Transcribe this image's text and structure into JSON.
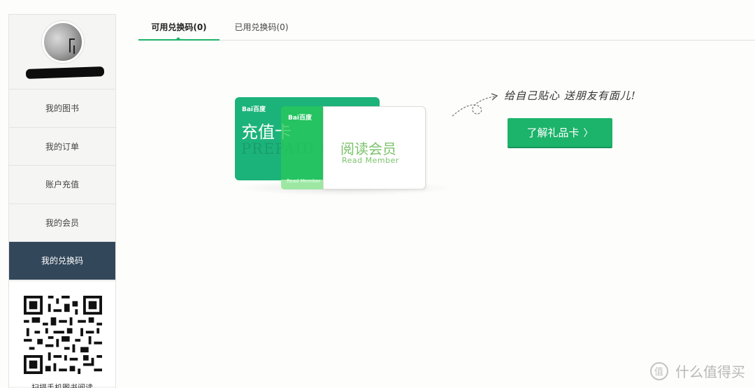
{
  "sidebar": {
    "items": [
      {
        "label": "我的图书"
      },
      {
        "label": "我的订单"
      },
      {
        "label": "账户充值"
      },
      {
        "label": "我的会员"
      },
      {
        "label": "我的兑换码"
      }
    ],
    "active_index": 4,
    "qr_caption": "扫描手机图书阅读"
  },
  "tabs": [
    {
      "label": "可用兑换码(0)"
    },
    {
      "label": "已用兑换码(0)"
    }
  ],
  "promo": {
    "card_back": {
      "brand": "Bai百度",
      "title": "充值卡",
      "watermark": "PREPAID CARD"
    },
    "card_front": {
      "brand": "Bai百度",
      "title": "阅读会员",
      "subtitle": "Read Member",
      "footer": "Read Member"
    },
    "slogan": "给自己贴心 送朋友有面儿!",
    "button_label": "了解礼品卡",
    "button_chevron": "〉"
  },
  "watermark": {
    "text": "什么值得买"
  },
  "colors": {
    "accent": "#1cb36a",
    "sidebar_active": "#33475b"
  }
}
